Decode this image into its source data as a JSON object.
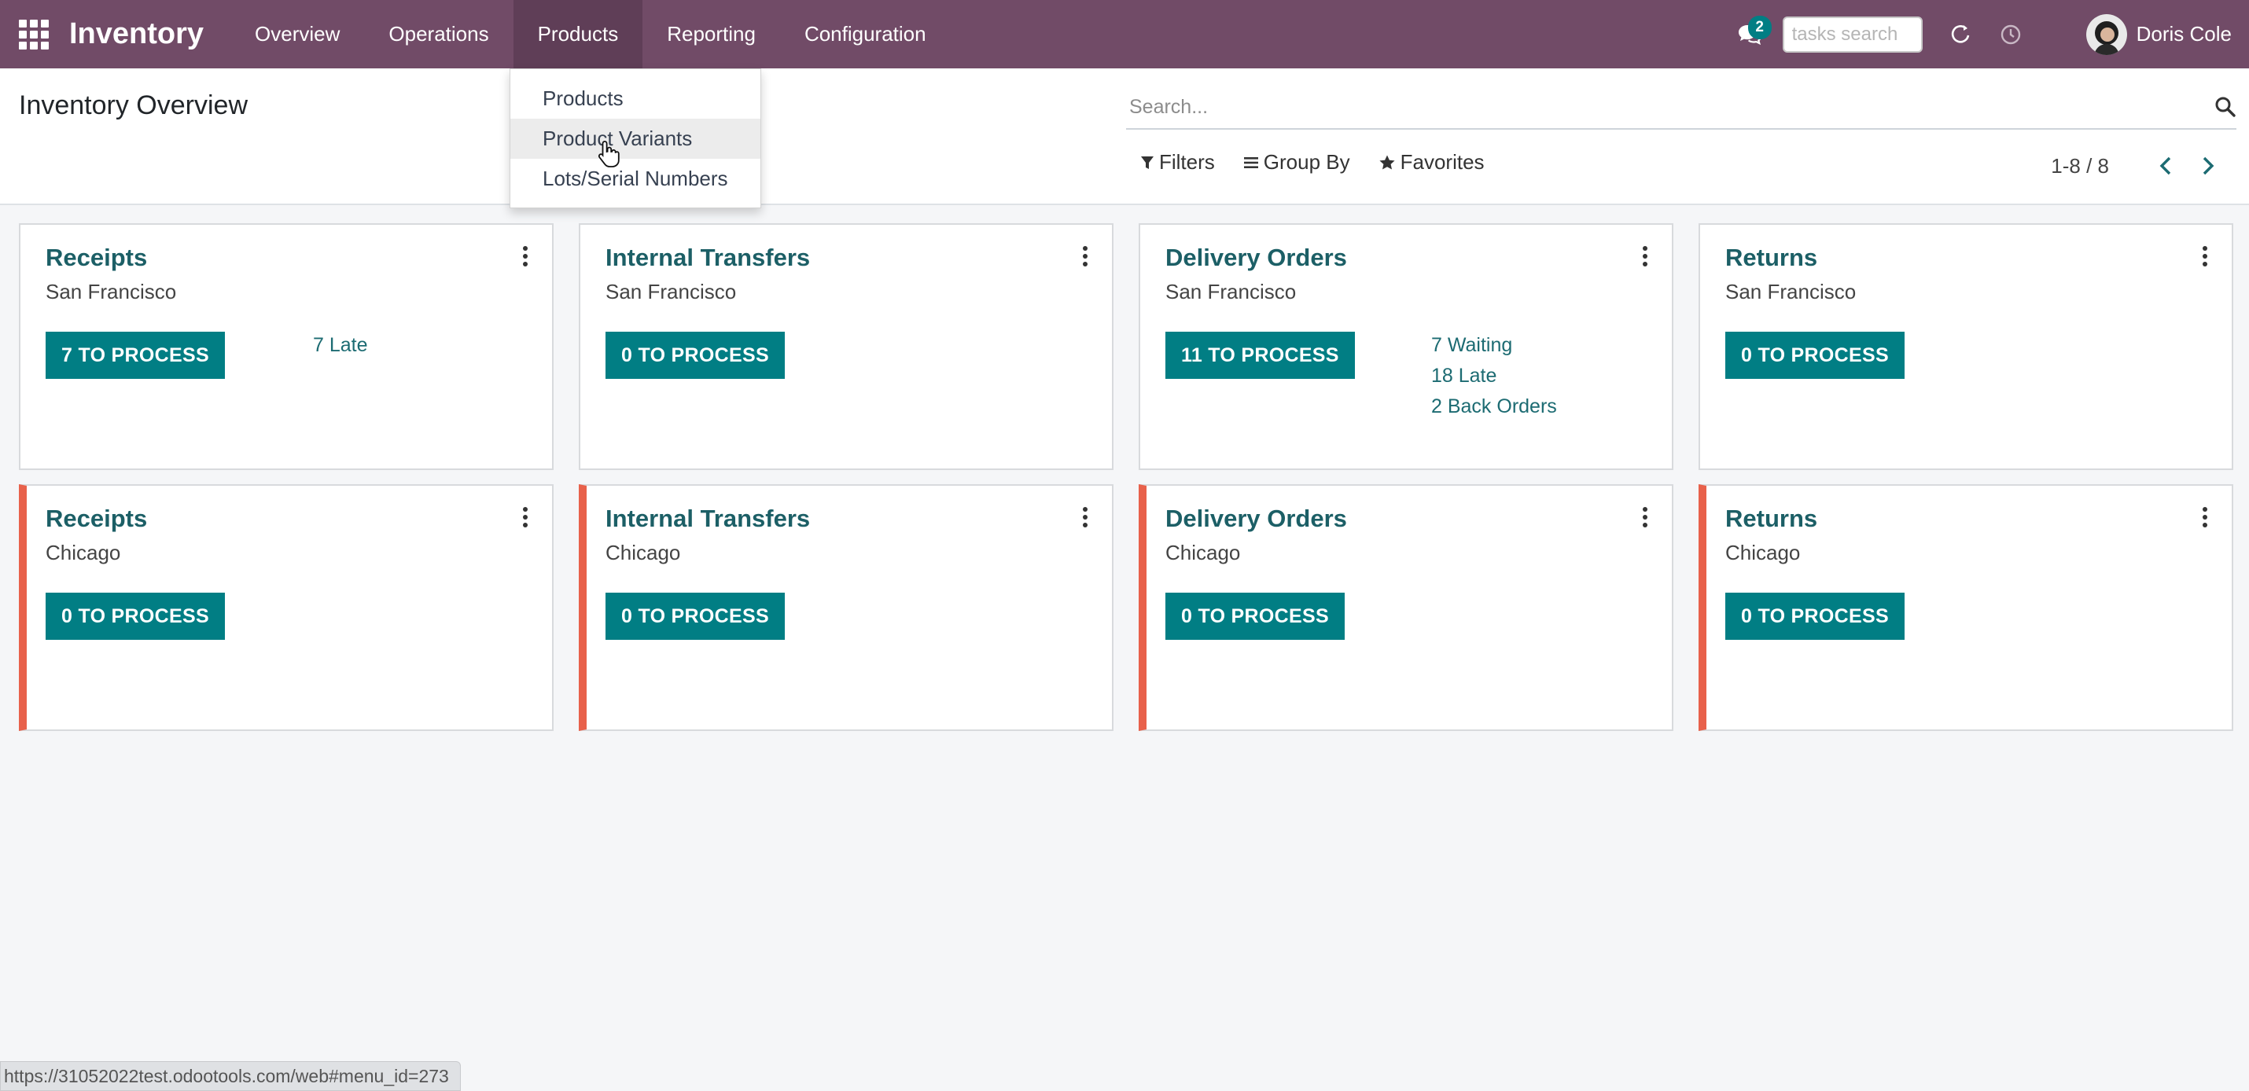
{
  "navbar": {
    "brand": "Inventory",
    "menu": [
      "Overview",
      "Operations",
      "Products",
      "Reporting",
      "Configuration"
    ],
    "active_menu": "Products",
    "chat_count": "2",
    "tasks_search_placeholder": "tasks search",
    "user_name": "Doris Cole",
    "bg_color": "#714b67"
  },
  "control_panel": {
    "title": "Inventory Overview",
    "search_placeholder": "Search...",
    "filters_label": "Filters",
    "group_by_label": "Group By",
    "favorites_label": "Favorites",
    "pager": "1-8 / 8"
  },
  "dropdown": {
    "items": [
      "Products",
      "Product Variants",
      "Lots/Serial Numbers"
    ],
    "hovered": "Product Variants"
  },
  "cards": [
    {
      "title": "Receipts",
      "location": "San Francisco",
      "button": "7 TO PROCESS",
      "links": [
        "7 Late"
      ]
    },
    {
      "title": "Internal Transfers",
      "location": "San Francisco",
      "button": "0 TO PROCESS",
      "links": []
    },
    {
      "title": "Delivery Orders",
      "location": "San Francisco",
      "button": "11 TO PROCESS",
      "links": [
        "7 Waiting",
        "18 Late",
        "2 Back Orders"
      ]
    },
    {
      "title": "Returns",
      "location": "San Francisco",
      "button": "0 TO PROCESS",
      "links": []
    },
    {
      "title": "Receipts",
      "location": "Chicago",
      "button": "0 TO PROCESS",
      "links": []
    },
    {
      "title": "Internal Transfers",
      "location": "Chicago",
      "button": "0 TO PROCESS",
      "links": []
    },
    {
      "title": "Delivery Orders",
      "location": "Chicago",
      "button": "0 TO PROCESS",
      "links": []
    },
    {
      "title": "Returns",
      "location": "Chicago",
      "button": "0 TO PROCESS",
      "links": []
    }
  ],
  "status_url": "https://31052022test.odootools.com/web#menu_id=273"
}
